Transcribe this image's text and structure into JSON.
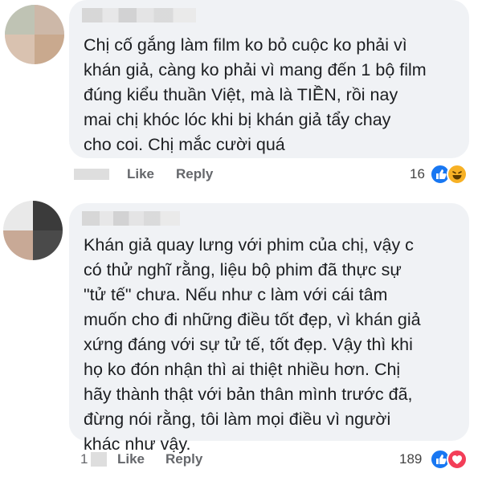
{
  "comments": [
    {
      "text": "Chị cố gắng làm film ko bỏ cuộc ko phải vì\nkhán giả, càng ko phải vì mang đến 1 bộ film\nđúng kiểu thuần Việt, mà là TIỀN, rồi nay\nmai chị khóc lóc khi bị khán giả tẩy chay\ncho coi. Chị mắc cười quá",
      "like_label": "Like",
      "reply_label": "Reply",
      "reaction_count": "16",
      "reactions": [
        "like",
        "haha"
      ]
    },
    {
      "text": "Khán giả quay lưng với phim của chị, vậy c\ncó thử nghĩ rằng, liệu bộ phim đã thực sự\n\"tử tế\" chưa. Nếu như c làm với cái tâm\nmuốn cho đi những điều tốt đẹp, vì khán giả\nxứng đáng với sự tử tế, tốt đẹp. Vậy thì khi\nhọ ko đón nhận thì ai thiệt nhiều hơn. Chị\nhãy thành thật với bản thân mình trước đã,\nđừng nói rằng, tôi làm mọi điều vì người\nkhác như vậy.",
      "time_prefix": "1",
      "like_label": "Like",
      "reply_label": "Reply",
      "reaction_count": "189",
      "reactions": [
        "like",
        "love"
      ]
    }
  ],
  "colors": {
    "bubble": "#f0f2f5",
    "action_text": "#65676b",
    "like": "#1877f2",
    "haha": "#f7b125",
    "love": "#f33e58"
  }
}
